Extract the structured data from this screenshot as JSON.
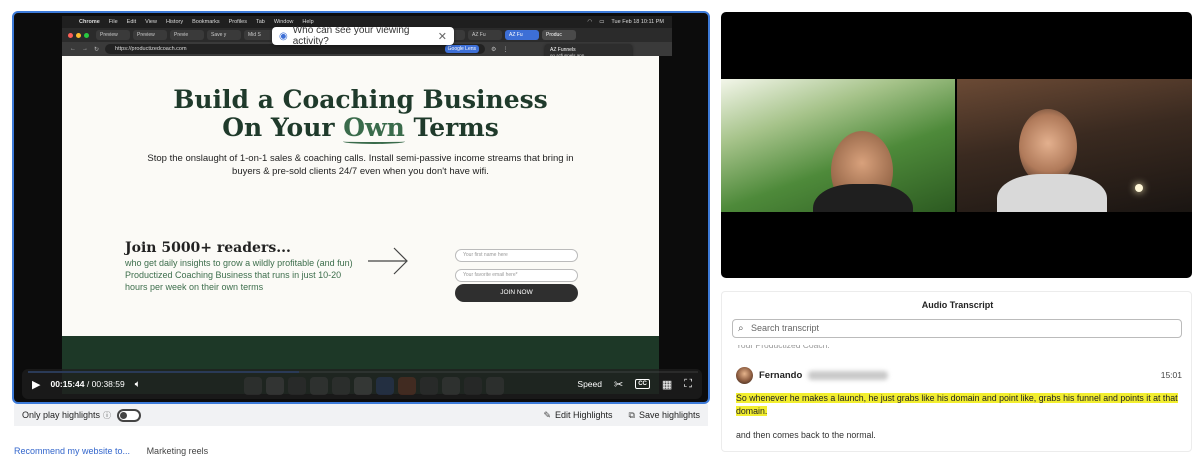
{
  "recording": {
    "mac_menu": {
      "app": "Chrome",
      "items": [
        "File",
        "Edit",
        "View",
        "History",
        "Bookmarks",
        "Profiles",
        "Tab",
        "Window",
        "Help"
      ],
      "clock": "Tue Feb 18 10:11 PM"
    },
    "tabs": [
      "Preview",
      "Preview",
      "Previe",
      "Save y",
      "Mid S",
      "Fresco",
      "AZ Fu",
      "AZ Fu",
      "Produc"
    ],
    "url": "https://productizedcoach.com",
    "google_lens": "Google Lens",
    "privacy_popup": "Who can see your viewing activity?",
    "tooltip": {
      "title": "AZ Funnels",
      "domain": "go.azfunnels.app",
      "memory": "High memory usage: 603 MB"
    },
    "site": {
      "title_line1": "Build a Coaching Business",
      "title_line2_pre": "On Your ",
      "title_line2_own": "Own",
      "title_line2_post": " Terms",
      "subtitle": "Stop the onslaught of 1-on-1 sales & coaching calls. Install semi-passive income streams that bring in buyers & pre-sold clients 24/7 even when you don't have wifi.",
      "join_heading": "Join 5000+ readers...",
      "join_text": "who get daily insights to grow a wildly profitable (and fun) Productized Coaching Business that runs in just 10-20 hours per week on their own terms",
      "name_placeholder": "Your first name here",
      "email_placeholder": "Your favorite email here*",
      "join_button": "JOIN NOW"
    }
  },
  "player": {
    "current_time": "00:15:44",
    "separator": "/",
    "duration": "00:38:59",
    "progress_fraction": 0.404,
    "speed_label": "Speed",
    "cc_label": "CC",
    "accent": "#3d7bd9"
  },
  "highlights_bar": {
    "only_play": "Only play highlights",
    "info": "ⓘ",
    "edit": "Edit Highlights",
    "save": "Save highlights"
  },
  "below_links": {
    "first": "Recommend my website to...",
    "second": "Marketing reels"
  },
  "transcript": {
    "title": "Audio Transcript",
    "search_placeholder": "Search transcript",
    "cut_line": "Your Productized Coach.",
    "speaker": "Fernando",
    "time": "15:01",
    "highlighted_text": "So whenever he makes a launch, he just grabs like his domain and point like, grabs his funnel and points it at that domain.",
    "plain_text": "and then comes back to the normal.",
    "highlight_color": "#f2ee2f"
  }
}
